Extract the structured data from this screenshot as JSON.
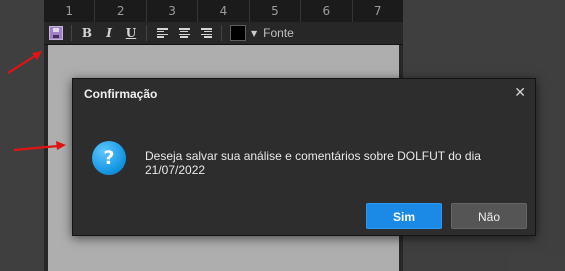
{
  "ruler": {
    "ticks": [
      "1",
      "2",
      "3",
      "4",
      "5",
      "6",
      "7"
    ]
  },
  "toolbar": {
    "bold_label": "B",
    "italic_label": "I",
    "underline_label": "U",
    "font_label": "Fonte",
    "text_color": "#000000"
  },
  "dialog": {
    "title": "Confirmação",
    "close_symbol": "✕",
    "icon_glyph": "?",
    "message": "Deseja salvar sua análise e comentários sobre DOLFUT do dia 21/07/2022",
    "yes_label": "Sim",
    "no_label": "Não"
  },
  "colors": {
    "accent": "#1a8ae6",
    "annotation_arrow": "#e11414"
  }
}
